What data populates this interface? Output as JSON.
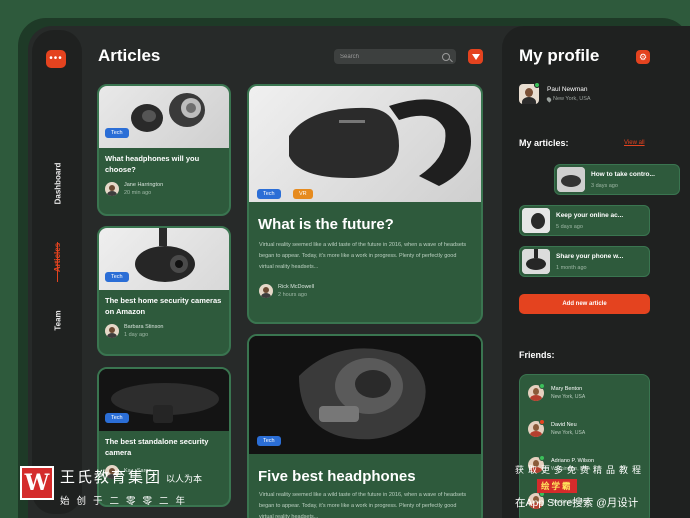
{
  "sidebar": {
    "menu_icon": "dots-icon",
    "items": [
      {
        "label": "Dashboard",
        "active": false
      },
      {
        "label": "Articles",
        "active": true
      },
      {
        "label": "Team",
        "active": false
      }
    ]
  },
  "header": {
    "title": "Articles",
    "search_placeholder": "Search"
  },
  "articles": [
    {
      "tag": "Tech",
      "title": "What headphones will you choose?",
      "author": "Jane Harrington",
      "time": "20 min ago",
      "image": "earbuds-image"
    },
    {
      "tag": "Tech",
      "title": "The best home security cameras on Amazon",
      "author": "Barbara Stinson",
      "time": "1 day ago",
      "image": "security-camera-image"
    },
    {
      "tag": "Tech",
      "title": "The best standalone security camera",
      "author": "Ka... Sargn...",
      "time": "",
      "image": "standalone-camera-image"
    },
    {
      "tags": [
        "Tech",
        "VR"
      ],
      "title": "What is the future?",
      "excerpt": "Virtual reality seemed like a wild taste of the future in 2016, when a wave of headsets began to appear. Today, it's more like a work in progress. Plenty of perfectly good virtual reality headsets...",
      "author": "Rick McDowell",
      "time": "2 hours ago",
      "image": "vr-headset-image"
    },
    {
      "tag": "Tech",
      "title": "Five best headphones",
      "excerpt": "Virtual reality seemed like a wild taste of the future in 2016, when a wave of headsets began to appear. Today, it's more like a work in progress. Plenty of perfectly good virtual reality headsets...",
      "image": "headphone-cutaway-image"
    }
  ],
  "profile": {
    "title": "My profile",
    "settings_icon": "gear-icon",
    "name": "Paul Newman",
    "location": "New York, USA",
    "my_articles_title": "My articles:",
    "view_all": "View all",
    "my_articles": [
      {
        "title": "How to take contro...",
        "date": "3 days ago"
      },
      {
        "title": "Keep your online ac...",
        "date": "5 days ago"
      },
      {
        "title": "Share your phone w...",
        "date": "1 month ago"
      }
    ],
    "add_button": "Add new article",
    "friends_title": "Friends:",
    "friends": [
      {
        "name": "Mary Benton",
        "location": "New York, USA",
        "status_color": "#3cc05a"
      },
      {
        "name": "David Neu",
        "location": "New York, USA",
        "status_color": "#e4431f"
      },
      {
        "name": "Adriano P. Wilson",
        "location": "Washington, USA",
        "status_color": "#3cc05a"
      },
      {
        "name": "",
        "location": "Washington, USA",
        "status_color": "#3cc05a"
      }
    ]
  },
  "watermark": {
    "logo": "W",
    "brand": "王氏教育集团",
    "slogan": "以人为本",
    "sub": "始创于二零零二年",
    "right_line1": "获取更多免费精品教程",
    "right_badge": "绘学霸",
    "right_line3": "在App Store搜索 @月设计"
  },
  "colors": {
    "accent": "#e4431f",
    "card_green": "#2e5a3c",
    "panel_dark": "#1f2120",
    "tag_blue": "#2b6ed6",
    "tag_orange": "#e68b1f"
  }
}
